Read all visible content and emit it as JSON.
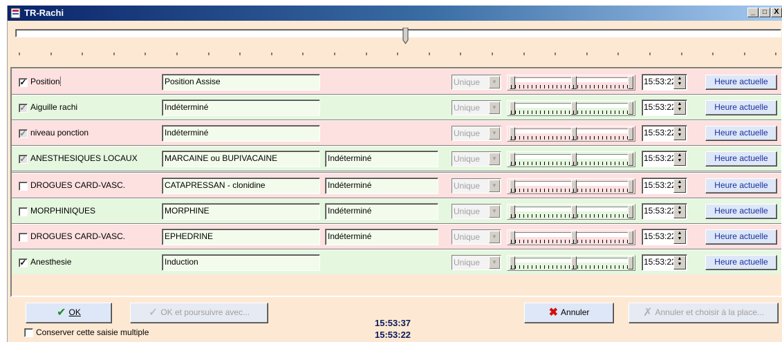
{
  "window": {
    "title": "TR-Rachi",
    "minimize": "_",
    "maximize": "□",
    "close": "X"
  },
  "colors": {
    "title_start": "#0a246a",
    "title_end": "#a6caf0",
    "pink": "#fde0e0",
    "green": "#e5f7df",
    "link_blue": "#1a2e9e"
  },
  "timeline": {
    "position": 0.51
  },
  "rows": [
    {
      "checked": true,
      "enabled": true,
      "label": "Position",
      "field1": "Position Assise",
      "field2": "",
      "mode": "Unique",
      "time": "15:53:22",
      "now": "Heure actuelle",
      "color": "pink"
    },
    {
      "checked": true,
      "enabled": false,
      "label": "Aiguille rachi",
      "field1": "Indéterminé",
      "field2": "",
      "mode": "Unique",
      "time": "15:53:22",
      "now": "Heure actuelle",
      "color": "green"
    },
    {
      "checked": true,
      "enabled": false,
      "label": "niveau ponction",
      "field1": "Indéterminé",
      "field2": "",
      "mode": "Unique",
      "time": "15:53:22",
      "now": "Heure actuelle",
      "color": "pink"
    },
    {
      "checked": true,
      "enabled": false,
      "label": "ANESTHESIQUES LOCAUX",
      "field1": "MARCAINE ou BUPIVACAINE",
      "field2": "Indéterminé",
      "mode": "Unique",
      "time": "15:53:22",
      "now": "Heure actuelle",
      "color": "green"
    },
    {
      "checked": false,
      "enabled": true,
      "label": "DROGUES  CARD-VASC.",
      "field1": "CATAPRESSAN - clonidine",
      "field2": "Indéterminé",
      "mode": "Unique",
      "time": "15:53:22",
      "now": "Heure actuelle",
      "color": "pink"
    },
    {
      "checked": false,
      "enabled": true,
      "label": "MORPHINIQUES",
      "field1": "MORPHINE",
      "field2": "Indéterminé",
      "mode": "Unique",
      "time": "15:53:22",
      "now": "Heure actuelle",
      "color": "green"
    },
    {
      "checked": false,
      "enabled": true,
      "label": "DROGUES  CARD-VASC.",
      "field1": "EPHEDRINE",
      "field2": "Indéterminé",
      "mode": "Unique",
      "time": "15:53:22",
      "now": "Heure actuelle",
      "color": "pink"
    },
    {
      "checked": true,
      "enabled": true,
      "label": "Anesthesie",
      "field1": "Induction",
      "field2": "",
      "mode": "Unique",
      "time": "15:53:22",
      "now": "Heure actuelle",
      "color": "green"
    }
  ],
  "footer": {
    "ok": "OK",
    "ok_continue": "OK et poursuivre avec...",
    "cancel": "Annuler",
    "cancel_choose": "Annuler et choisir à la place...",
    "keep_label": "Conserver cette saisie multiple",
    "keep_checked": false,
    "clock1": "15:53:37",
    "clock2": "15:53:22"
  }
}
